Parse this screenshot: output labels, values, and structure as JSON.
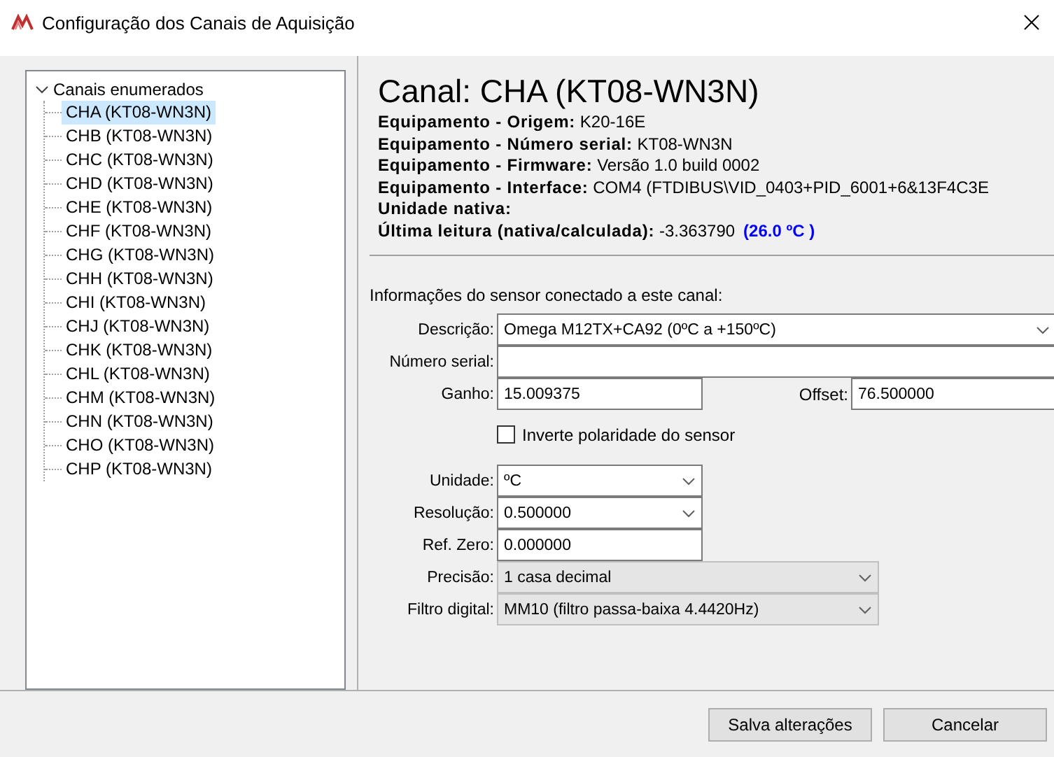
{
  "window": {
    "title": "Configuração dos Canais de Aquisição"
  },
  "tree": {
    "label": "Canais enumerados",
    "expanded": true,
    "children": [
      {
        "label": "CHA (KT08-WN3N)",
        "selected": true
      },
      {
        "label": "CHB (KT08-WN3N)",
        "selected": false
      },
      {
        "label": "CHC (KT08-WN3N)",
        "selected": false
      },
      {
        "label": "CHD (KT08-WN3N)",
        "selected": false
      },
      {
        "label": "CHE (KT08-WN3N)",
        "selected": false
      },
      {
        "label": "CHF (KT08-WN3N)",
        "selected": false
      },
      {
        "label": "CHG (KT08-WN3N)",
        "selected": false
      },
      {
        "label": "CHH (KT08-WN3N)",
        "selected": false
      },
      {
        "label": "CHI (KT08-WN3N)",
        "selected": false
      },
      {
        "label": "CHJ (KT08-WN3N)",
        "selected": false
      },
      {
        "label": "CHK (KT08-WN3N)",
        "selected": false
      },
      {
        "label": "CHL (KT08-WN3N)",
        "selected": false
      },
      {
        "label": "CHM (KT08-WN3N)",
        "selected": false
      },
      {
        "label": "CHN (KT08-WN3N)",
        "selected": false
      },
      {
        "label": "CHO (KT08-WN3N)",
        "selected": false
      },
      {
        "label": "CHP (KT08-WN3N)",
        "selected": false
      }
    ]
  },
  "details": {
    "heading": "Canal: CHA (KT08-WN3N)",
    "info": [
      {
        "label": "Equipamento - Origem:",
        "value": "K20-16E"
      },
      {
        "label": "Equipamento - Número serial:",
        "value": "KT08-WN3N"
      },
      {
        "label": "Equipamento - Firmware:",
        "value": "Versão 1.0 build 0002"
      },
      {
        "label": "Equipamento - Interface:",
        "value": "COM4 (FTDIBUS\\VID_0403+PID_6001+6&13F4C3E"
      },
      {
        "label": "Unidade nativa:"
      },
      {
        "label": "Última leitura (nativa/calculada):",
        "value": "-3.363790",
        "reading": "(26.0 ºC )"
      }
    ]
  },
  "sensor": {
    "title": "Informações do sensor conectado a este canal:",
    "fields": [
      {
        "kind": "select",
        "label": "Descrição:",
        "value": "Omega M12TX+CA92 (0ºC a +150ºC)",
        "disabled": false
      },
      {
        "kind": "input",
        "label": "Número serial:"
      },
      {
        "kind": "pair",
        "label": "Ganho:",
        "value": "15.009375",
        "label2": "Offset:",
        "value2": "76.500000"
      },
      {
        "kind": "checkbox",
        "label": "Inverte polaridade do sensor",
        "checked": false
      },
      {
        "kind": "small-select",
        "label": "Unidade:",
        "value": "ºC",
        "disabled": false
      },
      {
        "kind": "small-select",
        "label": "Resolução:",
        "value": "0.500000",
        "disabled": false
      },
      {
        "kind": "small-input",
        "label": "Ref. Zero:",
        "value": "0.000000"
      },
      {
        "kind": "combo",
        "label": "Precisão:",
        "value": "1 casa decimal",
        "disabled": true
      },
      {
        "kind": "combo",
        "label": "Filtro digital:",
        "value": "MM10 (filtro passa-baixa 4.4420Hz)",
        "disabled": true
      }
    ]
  },
  "buttons": [
    {
      "label": "Salva alterações"
    },
    {
      "label": "Cancelar"
    }
  ]
}
